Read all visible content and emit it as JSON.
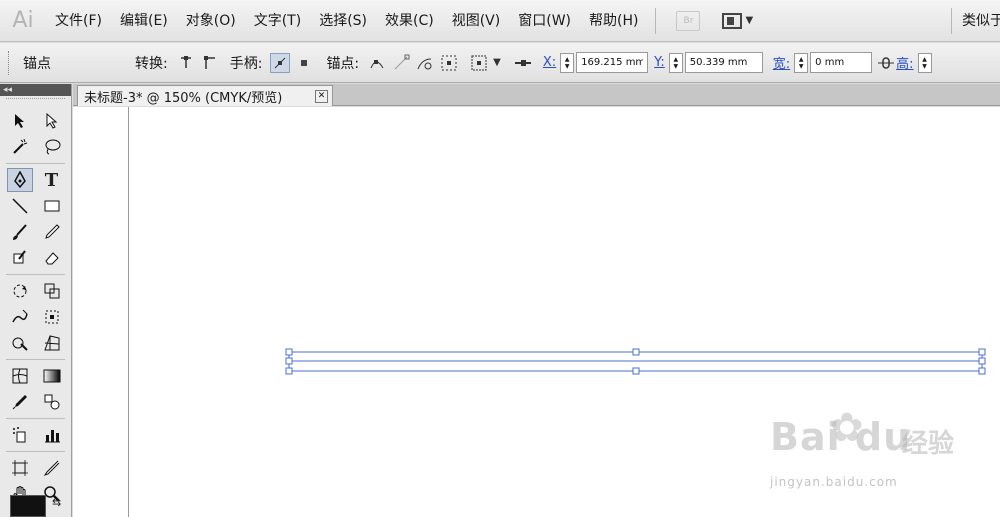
{
  "app": {
    "logo": "Ai",
    "bridge_label": "Br"
  },
  "menu": [
    {
      "id": "file",
      "label": "文件(F)"
    },
    {
      "id": "edit",
      "label": "编辑(E)"
    },
    {
      "id": "object",
      "label": "对象(O)"
    },
    {
      "id": "type",
      "label": "文字(T)"
    },
    {
      "id": "select",
      "label": "选择(S)"
    },
    {
      "id": "effect",
      "label": "效果(C)"
    },
    {
      "id": "view",
      "label": "视图(V)"
    },
    {
      "id": "window",
      "label": "窗口(W)"
    },
    {
      "id": "help",
      "label": "帮助(H)"
    }
  ],
  "menu_right": {
    "similar": "类似于"
  },
  "control": {
    "anchor_title": "锚点",
    "convert_label": "转换:",
    "handles_label": "手柄:",
    "anchors_label": "锚点:",
    "x_label": "X:",
    "x_value": "169.215 mm",
    "y_label": "Y:",
    "y_value": "50.339 mm",
    "w_label": "宽:",
    "w_value": "0 mm",
    "h_label": "高:"
  },
  "document": {
    "tab_title": "未标题-3* @ 150% (CMYK/预览)",
    "close_glyph": "✕"
  },
  "toolpanel": {
    "collapse_glyph": "◂◂"
  },
  "watermark": {
    "brand": "Bai  du",
    "cn": "经验",
    "url": "jingyan.baidu.com"
  },
  "colors": {
    "selection": "#4a6fd0",
    "anchor_fill": "#ffffff"
  }
}
